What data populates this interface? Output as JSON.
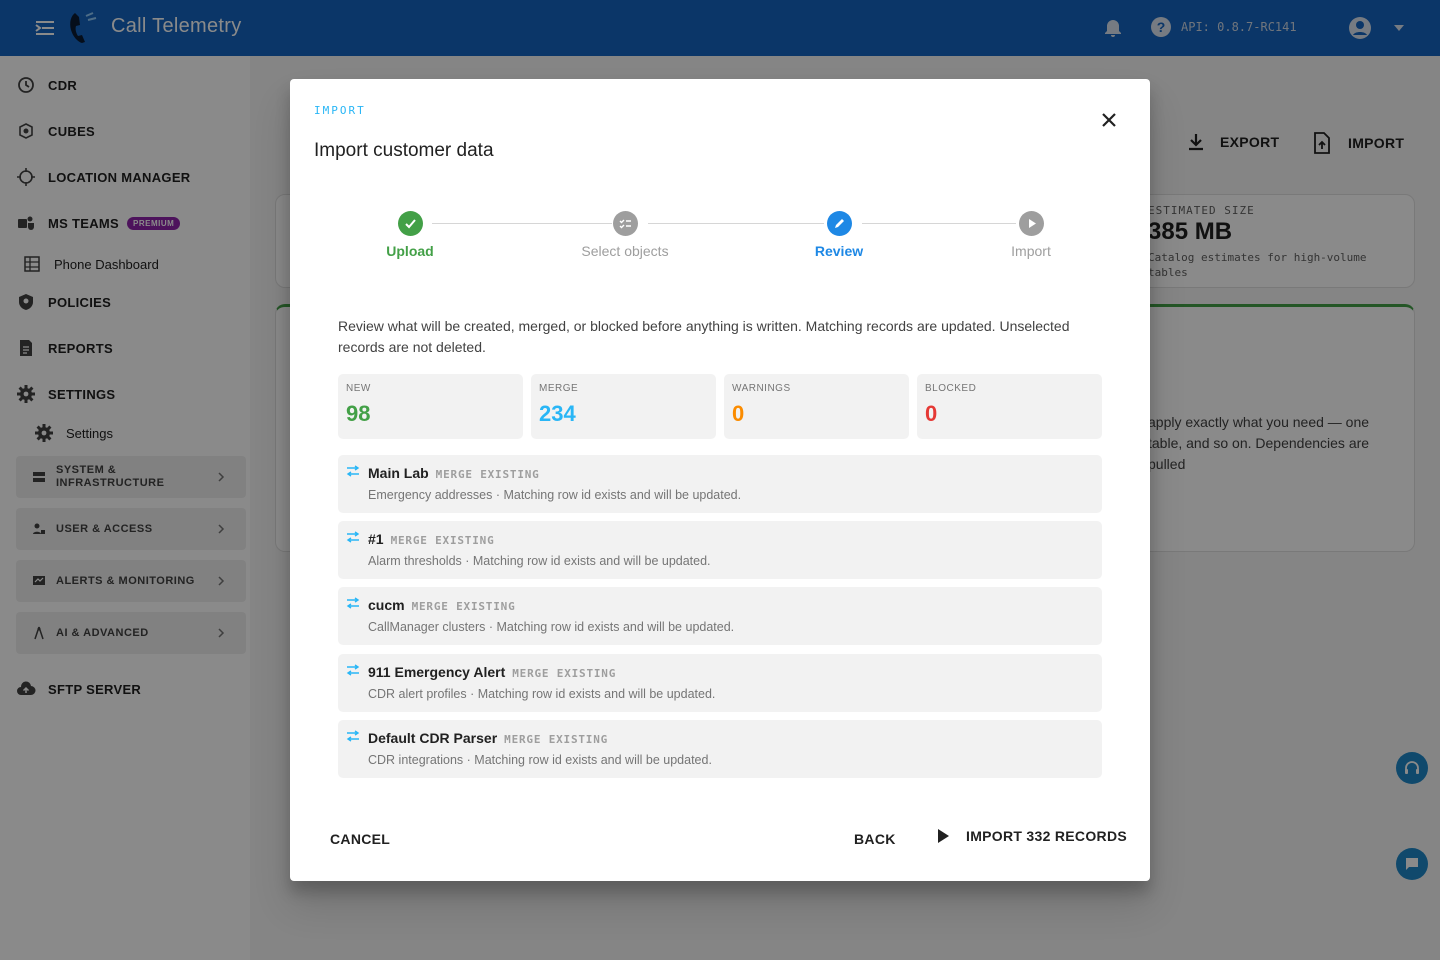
{
  "app": {
    "title": "Call Telemetry",
    "api_version": "API: 0.8.7-RC141"
  },
  "sidebar": {
    "items": [
      {
        "label": "CDR",
        "icon": "history-icon"
      },
      {
        "label": "CUBES",
        "icon": "cubes-icon"
      },
      {
        "label": "LOCATION MANAGER",
        "icon": "crosshair-icon"
      },
      {
        "label": "MS TEAMS",
        "icon": "teams-icon",
        "badge": "PREMIUM"
      },
      {
        "label": "POLICIES",
        "icon": "shield-icon"
      },
      {
        "label": "REPORTS",
        "icon": "report-icon"
      },
      {
        "label": "SETTINGS",
        "icon": "gear-icon"
      },
      {
        "label": "SFTP SERVER",
        "icon": "cloud-upload-icon"
      }
    ],
    "phone_dashboard": "Phone Dashboard",
    "settings_sub": "Settings",
    "groups": [
      {
        "label": "SYSTEM & INFRASTRUCTURE"
      },
      {
        "label": "USER & ACCESS"
      },
      {
        "label": "ALERTS & MONITORING"
      },
      {
        "label": "AI & ADVANCED"
      }
    ]
  },
  "background": {
    "export_label": "EXPORT",
    "import_label": "IMPORT",
    "estimated_size_label": "ESTIMATED SIZE",
    "estimated_size_value": "385 MB",
    "estimated_size_note": "Catalog estimates for high-volume tables",
    "description": "apply exactly what you need — one table, and so on. Dependencies are pulled"
  },
  "modal": {
    "eyebrow": "IMPORT",
    "title": "Import customer data",
    "steps": [
      {
        "label": "Upload",
        "state": "done"
      },
      {
        "label": "Select objects",
        "state": "done"
      },
      {
        "label": "Review",
        "state": "active"
      },
      {
        "label": "Import",
        "state": "pending"
      }
    ],
    "intro": "Review what will be created, merged, or blocked before anything is written. Matching records are updated. Unselected records are not deleted.",
    "stats": [
      {
        "label": "NEW",
        "value": "98",
        "color": "#43a047"
      },
      {
        "label": "MERGE",
        "value": "234",
        "color": "#29b6f6"
      },
      {
        "label": "WARNINGS",
        "value": "0",
        "color": "#fb8c00"
      },
      {
        "label": "BLOCKED",
        "value": "0",
        "color": "#e53935"
      }
    ],
    "records": [
      {
        "title": "Main Lab",
        "badge": "MERGE EXISTING",
        "subtitle": "Emergency addresses · Matching row id exists and will be updated."
      },
      {
        "title": "#1",
        "badge": "MERGE EXISTING",
        "subtitle": "Alarm thresholds · Matching row id exists and will be updated."
      },
      {
        "title": "cucm",
        "badge": "MERGE EXISTING",
        "subtitle": "CallManager clusters · Matching row id exists and will be updated."
      },
      {
        "title": "911 Emergency Alert",
        "badge": "MERGE EXISTING",
        "subtitle": "CDR alert profiles · Matching row id exists and will be updated."
      },
      {
        "title": "Default CDR Parser",
        "badge": "MERGE EXISTING",
        "subtitle": "CDR integrations · Matching row id exists and will be updated."
      }
    ],
    "cancel_label": "CANCEL",
    "back_label": "BACK",
    "import_label": "IMPORT 332 RECORDS"
  },
  "colors": {
    "appbar": "#1565c0",
    "step_done": "#43a047",
    "step_active": "#1e88e5",
    "step_pending": "#9e9e9e",
    "merge_accent": "#29b6f6"
  }
}
